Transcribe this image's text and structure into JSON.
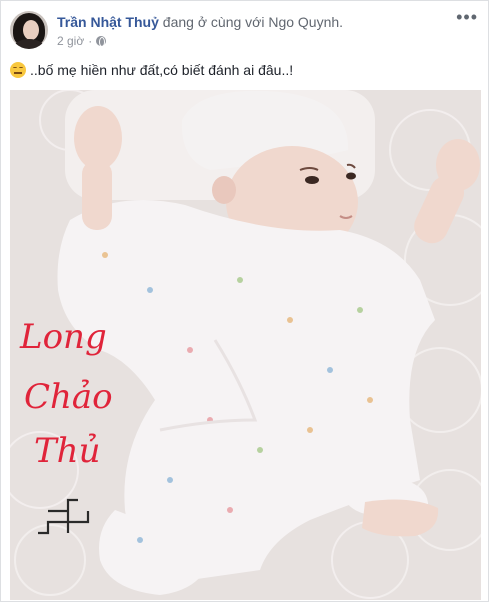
{
  "post": {
    "author": "Trần Nhật Thuỷ",
    "activity": "đang ở cùng với",
    "tagged": "Ngo Quynh.",
    "time": "2 giờ",
    "separator": "·",
    "privacy_icon": "globe-icon",
    "more_label": "•••",
    "caption": "..bố mẹ hiền như đất,có biết đánh ai đâu..!",
    "emoji": "smirk-emoji"
  },
  "photo": {
    "subject": "baby",
    "handwriting_lines": [
      "Long",
      "Chảo",
      "Thủ"
    ],
    "handwriting_color": "#e0243a",
    "symbol": "卍"
  }
}
